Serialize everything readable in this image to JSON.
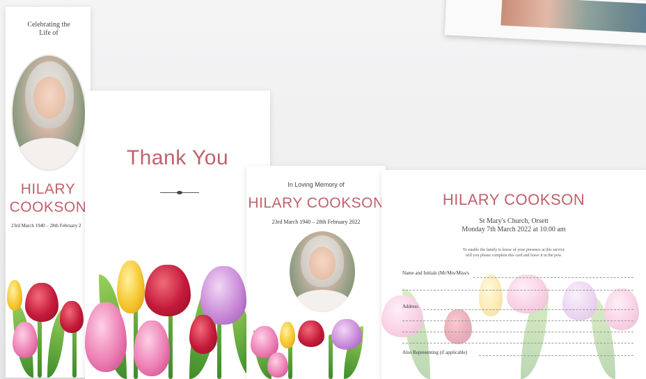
{
  "bookmark": {
    "celebrating": "Celebrating the Life of",
    "name_line1": "HILARY",
    "name_line2": "COOKSON",
    "dates": "23rd March 1940 – 28th February 2"
  },
  "thankyou": {
    "title": "Thank You"
  },
  "memory_card": {
    "in_loving_memory": "In Loving Memory of",
    "name": "HILARY COOKSON",
    "dates": "23rd March 1940 – 28th February 2022"
  },
  "attendance_card": {
    "name": "HILARY COOKSON",
    "venue": "St Mary's Church, Orsett",
    "date_time": "Monday 7th March 2022 at 10.00 am",
    "instruction_line1": "To enable the family to know of your presence at this service",
    "instruction_line2": "will you please complete this card and leave it in the pew.",
    "field_name": "Name and Initials (Mr/Mrs/Miss/s",
    "field_address": "Address",
    "field_representing": "Also Representing (if applicable)"
  },
  "colors": {
    "accent_name": "#c2606a",
    "background": "#f0f0f1"
  }
}
